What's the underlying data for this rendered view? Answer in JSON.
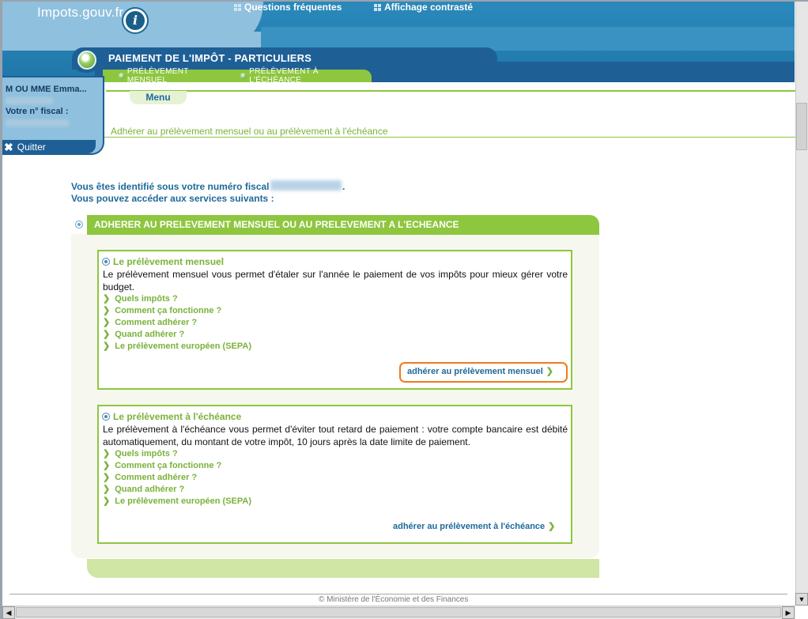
{
  "header": {
    "logo_text": "Impots.gouv.fr",
    "links": [
      "Questions fréquentes",
      "Affichage contrasté"
    ],
    "page_title": "PAIEMENT DE L'IMPÔT - PARTICULIERS",
    "subtabs": [
      "PRÉLÈVEMENT MENSUEL",
      "PRÉLÈVEMENT À L'ÉCHÉANCE"
    ]
  },
  "user": {
    "name": "M OU MME Emma...",
    "fiscal_label": "Votre n° fiscal :",
    "quit_label": "Quitter"
  },
  "menu": {
    "label": "Menu",
    "breadcrumb": "Adhérer au prélèvement mensuel ou au prélèvement à l'échéance"
  },
  "intro": {
    "line1": "Vous êtes identifié sous votre numéro fiscal",
    "line1_end": ".",
    "line2": "Vous pouvez accéder aux services suivants :"
  },
  "section": {
    "header": "ADHERER AU PRELEVEMENT MENSUEL OU AU PRELEVEMENT A L'ECHEANCE"
  },
  "monthly": {
    "title": "Le prélèvement mensuel",
    "description": "Le prélèvement mensuel vous permet d'étaler sur l'année le paiement de vos impôts pour mieux gérer votre budget.",
    "links": [
      "Quels impôts ?",
      "Comment ça fonctionne ?",
      "Comment adhérer ?",
      "Quand adhérer ?",
      "Le prélèvement européen (SEPA)"
    ],
    "action": "adhérer au prélèvement mensuel"
  },
  "due_date": {
    "title": "Le prélèvement à l'échéance",
    "description": "Le prélèvement à l'échéance vous permet d'éviter tout retard de paiement : votre compte bancaire est débité automatiquement, du montant de votre impôt, 10 jours après la date limite de paiement.",
    "links": [
      "Quels impôts ?",
      "Comment ça fonctionne ?",
      "Comment adhérer ?",
      "Quand adhérer ?",
      "Le prélèvement européen (SEPA)"
    ],
    "action": "adhérer au prélèvement à l'échéance"
  },
  "footer": {
    "copyright": "© Ministère de l'Économie et des Finances"
  },
  "colors": {
    "brand_blue": "#1e5f96",
    "header_blue": "#2b89bb",
    "accent_green": "#8ec63f",
    "link_green": "#7ab23a",
    "text_blue": "#1e6a9a",
    "highlight_orange": "#f07a1f"
  },
  "icons": {
    "info": "info-icon",
    "quit": "close-icon",
    "bullet": "chevron-right-icon",
    "section": "radio-ring-icon"
  }
}
